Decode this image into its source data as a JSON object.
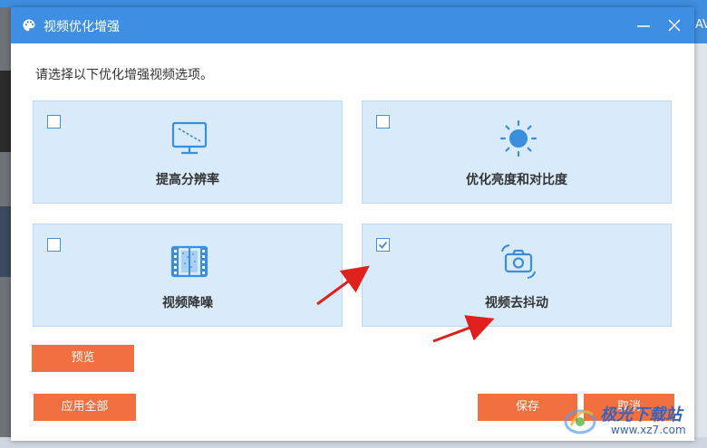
{
  "dialog": {
    "title": "视频优化增强",
    "instruction": "请选择以下优化增强视频选项。"
  },
  "options": [
    {
      "label": "提高分辨率",
      "checked": false,
      "icon": "monitor-icon"
    },
    {
      "label": "优化亮度和对比度",
      "checked": false,
      "icon": "brightness-icon"
    },
    {
      "label": "视频降噪",
      "checked": false,
      "icon": "film-icon"
    },
    {
      "label": "视频去抖动",
      "checked": true,
      "icon": "stabilize-camera-icon"
    }
  ],
  "buttons": {
    "preview": "预览",
    "apply_all": "应用全部",
    "save": "保存",
    "cancel": "取消"
  },
  "background": {
    "right_edge_text": "AV"
  },
  "watermark": {
    "brand": "极光下载站",
    "url": "www.xz7.com"
  },
  "colors": {
    "titlebar": "#3e8fe3",
    "accent": "#f2703f",
    "card_bg": "#d9ebfa",
    "icon_blue": "#3a8fdc",
    "arrow": "#e0201c"
  }
}
